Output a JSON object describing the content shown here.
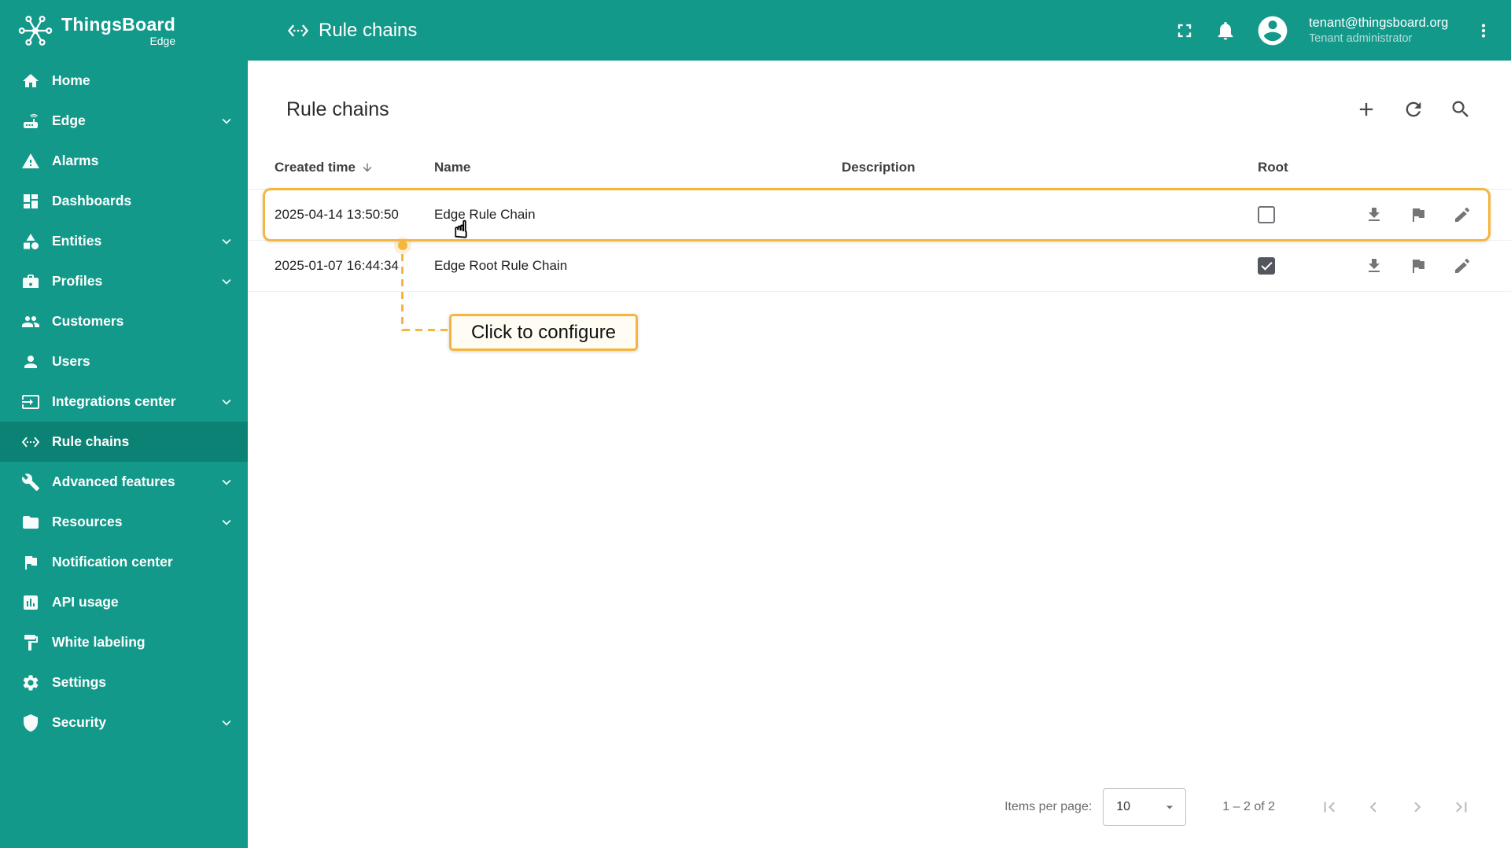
{
  "colors": {
    "primary": "#12998a",
    "primary_dark": "#0b8273",
    "accent": "#f4b63f"
  },
  "topbar": {
    "brand": "ThingsBoard",
    "brand_sub": "Edge",
    "page_title": "Rule chains",
    "user": {
      "email": "tenant@thingsboard.org",
      "role": "Tenant administrator"
    }
  },
  "sidebar": {
    "items": [
      {
        "label": "Home",
        "icon": "home-icon",
        "expandable": false,
        "active": false
      },
      {
        "label": "Edge",
        "icon": "edge-icon",
        "expandable": true,
        "active": false
      },
      {
        "label": "Alarms",
        "icon": "alarms-icon",
        "expandable": false,
        "active": false
      },
      {
        "label": "Dashboards",
        "icon": "dashboards-icon",
        "expandable": false,
        "active": false
      },
      {
        "label": "Entities",
        "icon": "entities-icon",
        "expandable": true,
        "active": false
      },
      {
        "label": "Profiles",
        "icon": "profiles-icon",
        "expandable": true,
        "active": false
      },
      {
        "label": "Customers",
        "icon": "customers-icon",
        "expandable": false,
        "active": false
      },
      {
        "label": "Users",
        "icon": "users-icon",
        "expandable": false,
        "active": false
      },
      {
        "label": "Integrations center",
        "icon": "integrations-icon",
        "expandable": true,
        "active": false
      },
      {
        "label": "Rule chains",
        "icon": "rule-chains-icon",
        "expandable": false,
        "active": true
      },
      {
        "label": "Advanced features",
        "icon": "advanced-features-icon",
        "expandable": true,
        "active": false
      },
      {
        "label": "Resources",
        "icon": "resources-icon",
        "expandable": true,
        "active": false
      },
      {
        "label": "Notification center",
        "icon": "notification-center-icon",
        "expandable": false,
        "active": false
      },
      {
        "label": "API usage",
        "icon": "api-usage-icon",
        "expandable": false,
        "active": false
      },
      {
        "label": "White labeling",
        "icon": "white-labeling-icon",
        "expandable": false,
        "active": false
      },
      {
        "label": "Settings",
        "icon": "settings-icon",
        "expandable": false,
        "active": false
      },
      {
        "label": "Security",
        "icon": "security-icon",
        "expandable": true,
        "active": false
      }
    ]
  },
  "main": {
    "card_title": "Rule chains",
    "table": {
      "columns": [
        "Created time",
        "Name",
        "Description",
        "Root"
      ],
      "sorted_by": "Created time",
      "sort_order": "desc"
    },
    "rows": [
      {
        "created_time": "2025-04-14 13:50:50",
        "name": "Edge Rule Chain",
        "description": "",
        "root": false
      },
      {
        "created_time": "2025-01-07 16:44:34",
        "name": "Edge Root Rule Chain",
        "description": "",
        "root": true
      }
    ],
    "annotation": {
      "label": "Click to configure"
    },
    "paginator": {
      "items_per_page_label": "Items per page:",
      "page_size": "10",
      "range": "1 – 2 of 2"
    }
  }
}
